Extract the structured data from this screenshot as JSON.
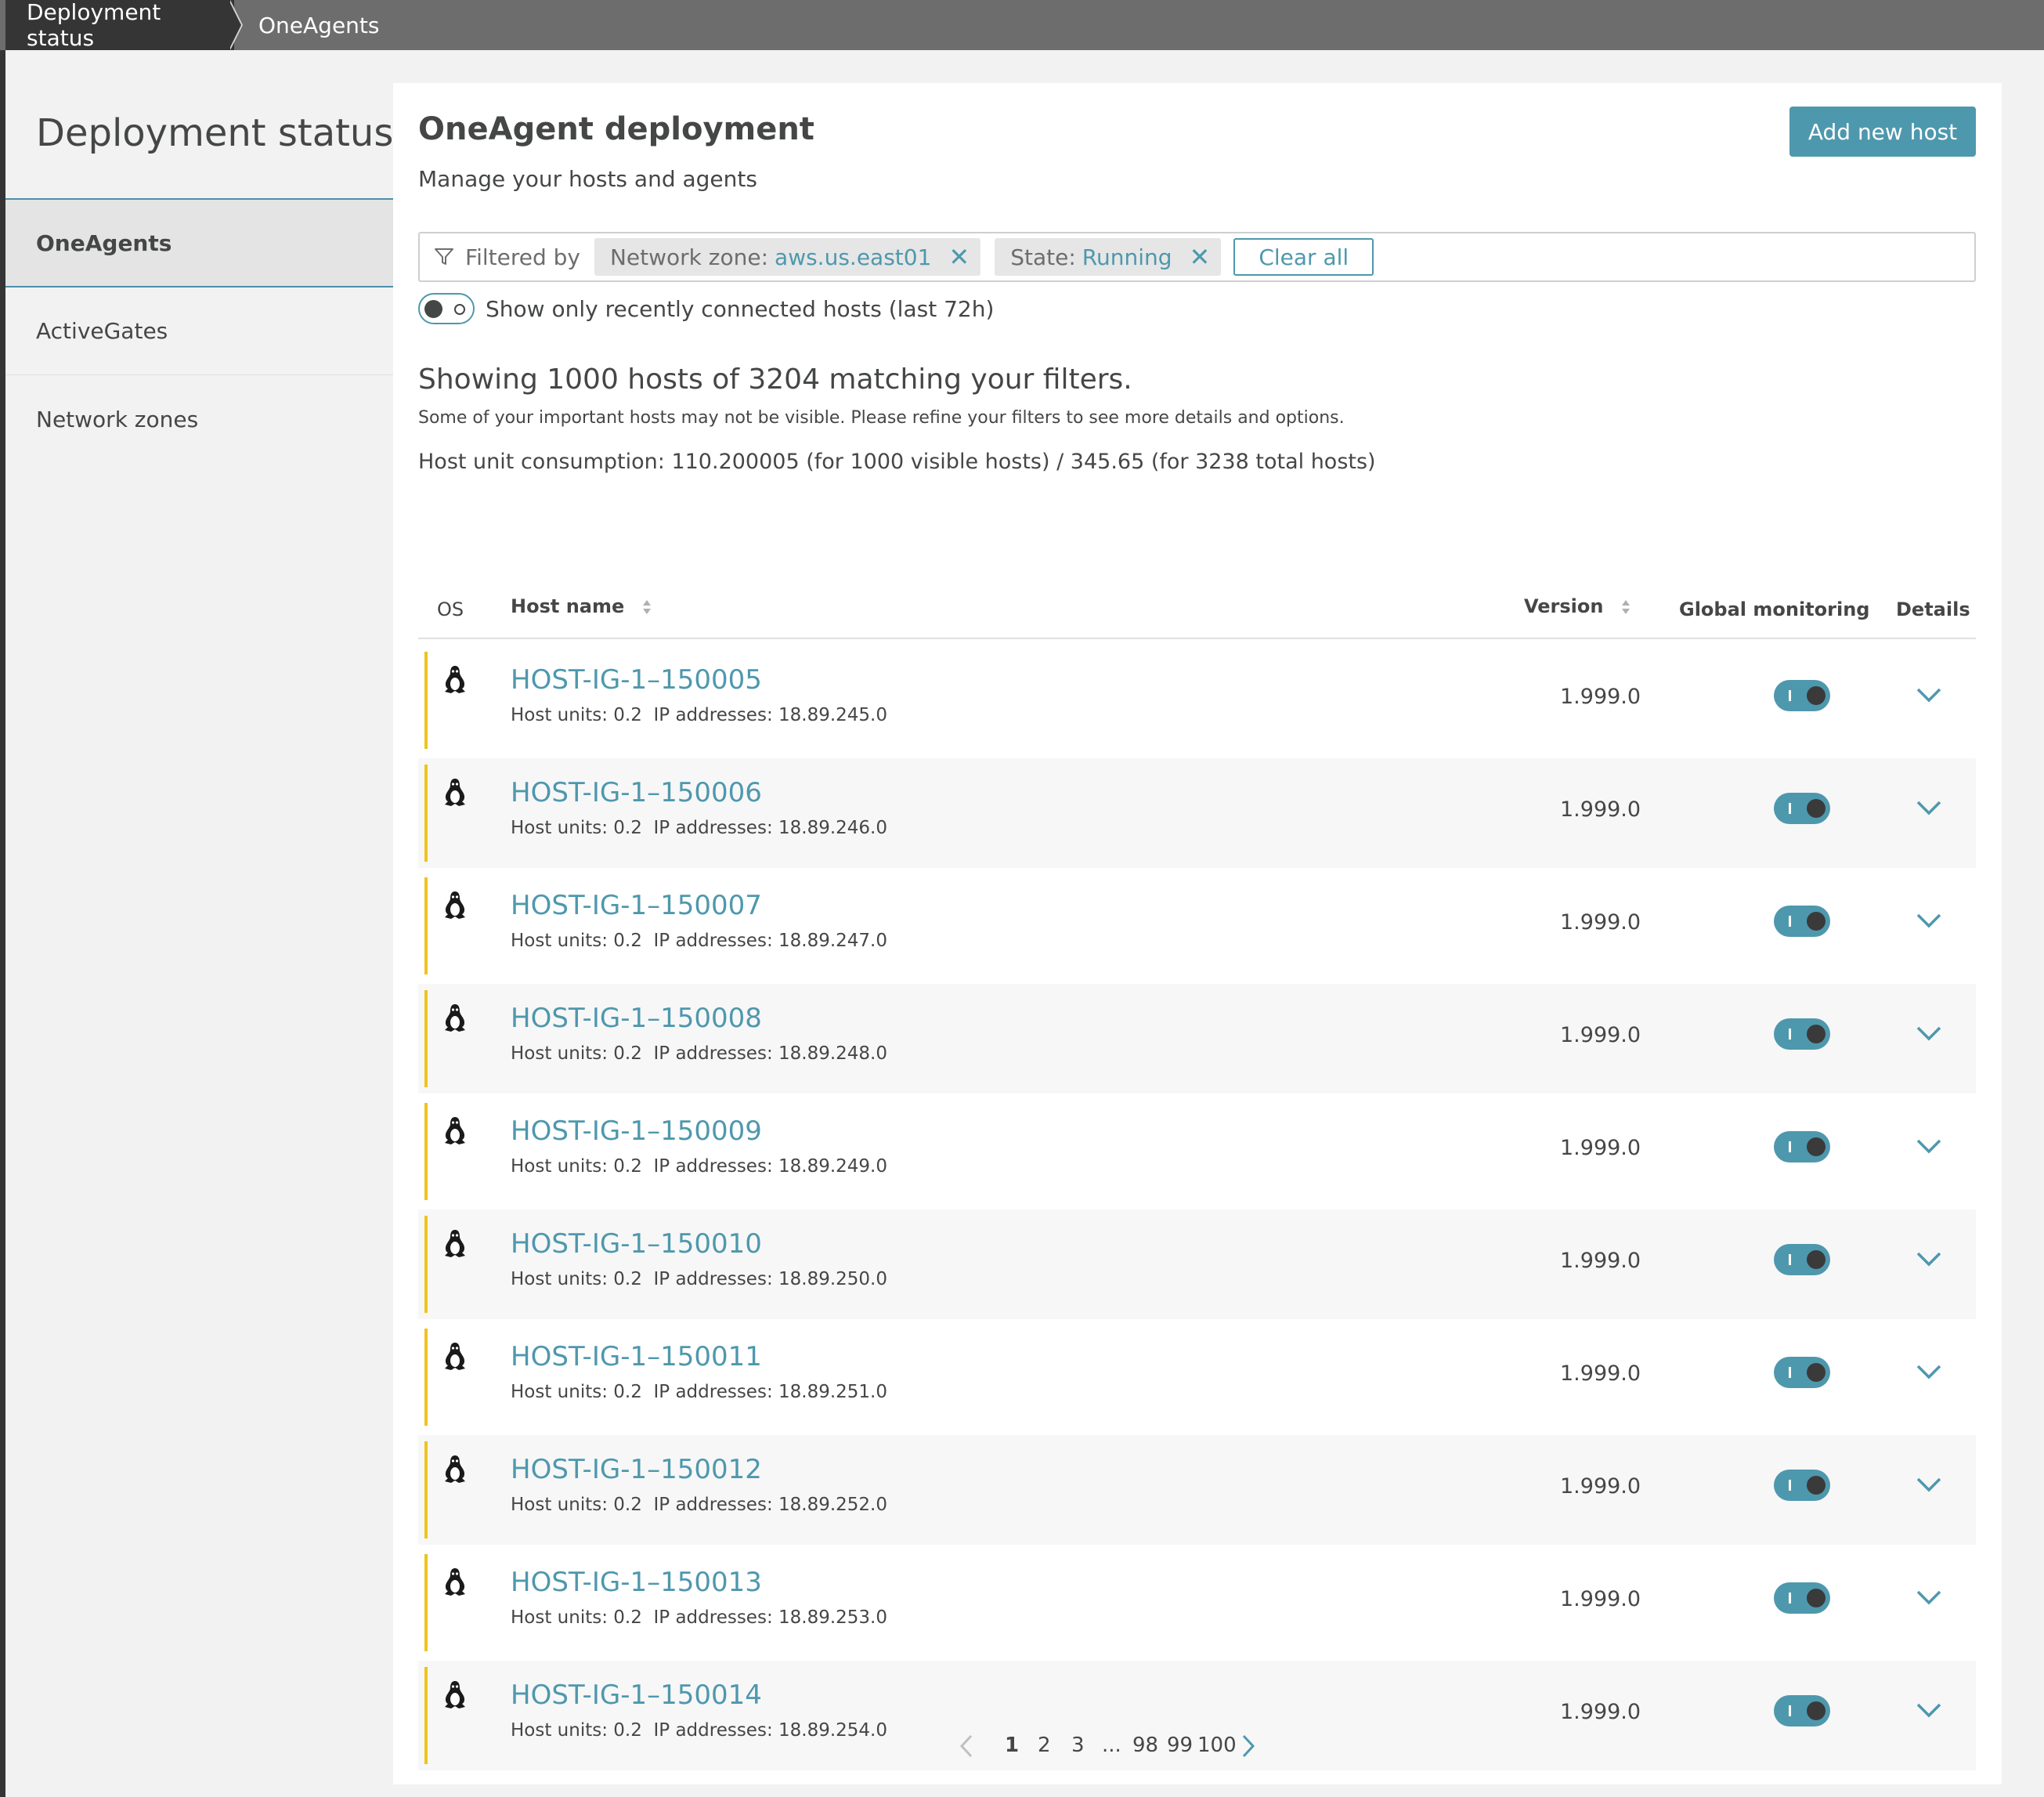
{
  "breadcrumb": {
    "first": "Deployment status",
    "second": "OneAgents"
  },
  "sidebar": {
    "title": "Deployment status",
    "items": [
      {
        "label": "OneAgents",
        "active": true
      },
      {
        "label": "ActiveGates",
        "active": false
      },
      {
        "label": "Network zones",
        "active": false
      }
    ]
  },
  "main": {
    "title": "OneAgent deployment",
    "subtitle": "Manage your hosts and agents",
    "add_button": "Add new host",
    "filter": {
      "label": "Filtered by",
      "chips": [
        {
          "key": "Network zone:",
          "value": "aws.us.east01"
        },
        {
          "key": "State:",
          "value": "Running"
        }
      ],
      "clear_all": "Clear all"
    },
    "recent_toggle_label": "Show only recently connected hosts (last 72h)",
    "showing": "Showing 1000 hosts of 3204 matching your filters.",
    "warning": "Some of your important hosts may not be visible. Please refine your filters to see more details and options.",
    "consumption": "Host unit consumption: 110.200005 (for 1000 visible hosts) / 345.65 (for 3238 total hosts)"
  },
  "table": {
    "headers": {
      "os": "OS",
      "host": "Host name",
      "version": "Version",
      "monitoring": "Global monitoring",
      "details": "Details"
    },
    "rows": [
      {
        "name": "HOST-IG-1–150005",
        "meta": "Host units: 0.2  IP addresses: 18.89.245.0",
        "version": "1.999.0"
      },
      {
        "name": "HOST-IG-1–150006",
        "meta": "Host units: 0.2  IP addresses: 18.89.246.0",
        "version": "1.999.0"
      },
      {
        "name": "HOST-IG-1–150007",
        "meta": "Host units: 0.2  IP addresses: 18.89.247.0",
        "version": "1.999.0"
      },
      {
        "name": "HOST-IG-1–150008",
        "meta": "Host units: 0.2  IP addresses: 18.89.248.0",
        "version": "1.999.0"
      },
      {
        "name": "HOST-IG-1–150009",
        "meta": "Host units: 0.2  IP addresses: 18.89.249.0",
        "version": "1.999.0"
      },
      {
        "name": "HOST-IG-1–150010",
        "meta": "Host units: 0.2  IP addresses: 18.89.250.0",
        "version": "1.999.0"
      },
      {
        "name": "HOST-IG-1–150011",
        "meta": "Host units: 0.2  IP addresses: 18.89.251.0",
        "version": "1.999.0"
      },
      {
        "name": "HOST-IG-1–150012",
        "meta": "Host units: 0.2  IP addresses: 18.89.252.0",
        "version": "1.999.0"
      },
      {
        "name": "HOST-IG-1–150013",
        "meta": "Host units: 0.2  IP addresses: 18.89.253.0",
        "version": "1.999.0"
      },
      {
        "name": "HOST-IG-1–150014",
        "meta": "Host units: 0.2  IP addresses: 18.89.254.0",
        "version": "1.999.0"
      }
    ]
  },
  "pagination": {
    "pages": [
      "1",
      "2",
      "3",
      "...",
      "98",
      "99",
      "100"
    ],
    "current": "1"
  },
  "colors": {
    "accent": "#4e98ad",
    "status_bar": "#f0c31d",
    "topbar": "#6d6d6d",
    "crumb_active": "#353535"
  },
  "icons": {
    "os": "linux-tux-icon",
    "filter": "filter-icon",
    "remove": "close-icon",
    "details": "chevron-down-icon",
    "sort": "sort-icon",
    "prev": "chevron-left-icon",
    "next": "chevron-right-icon"
  }
}
